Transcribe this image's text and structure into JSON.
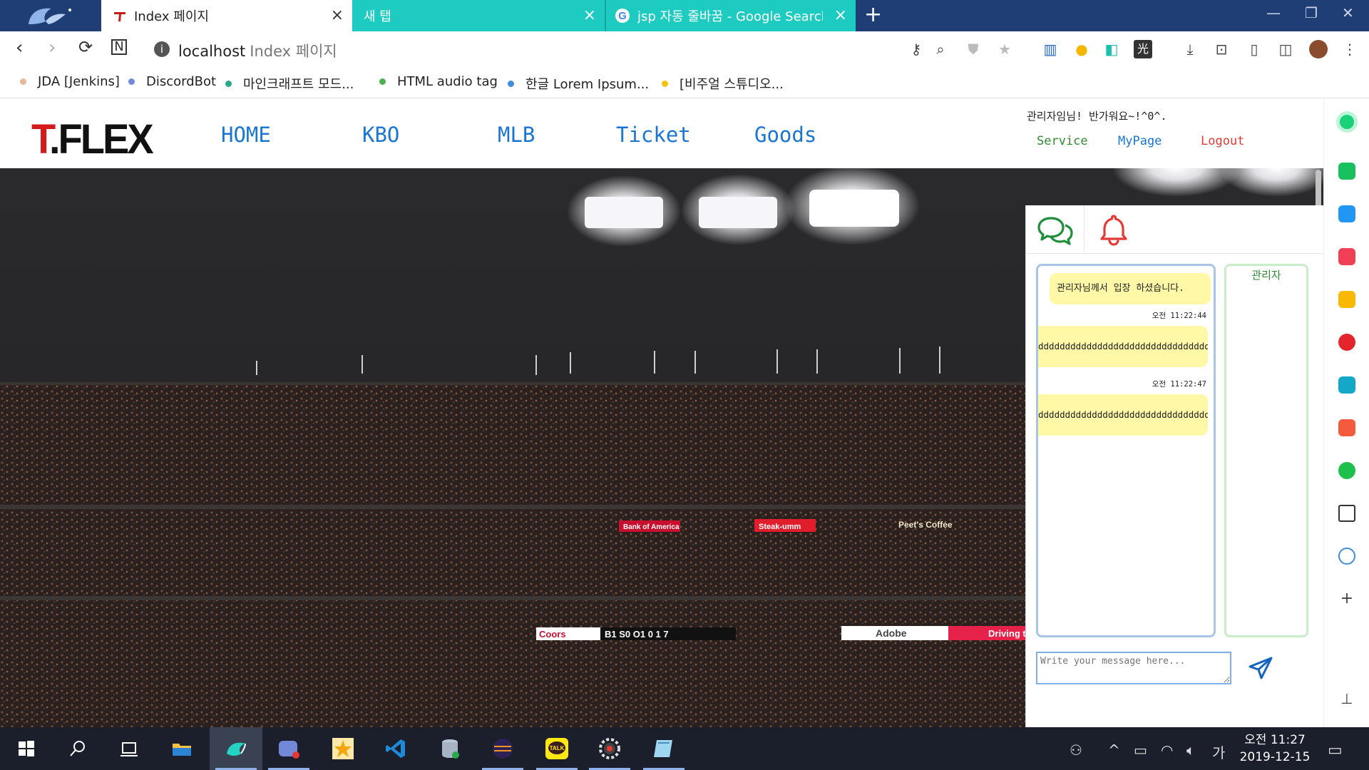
{
  "browser": {
    "tabs": [
      {
        "title": "Index 페이지"
      },
      {
        "title": "새 탭"
      },
      {
        "title": "jsp 자동 줄바꿈 - Google Search"
      }
    ],
    "url_host": "localhost",
    "url_hint": "Index 페이지",
    "bookmarks": [
      {
        "label": "JDA [Jenkins]",
        "color": "#e8b89c"
      },
      {
        "label": "DiscordBot",
        "color": "#7289da"
      },
      {
        "label": "마인크래프트 모드...",
        "color": "#2aa88a"
      },
      {
        "label": "HTML audio tag",
        "color": "#4caf50"
      },
      {
        "label": "한글 Lorem Ipsum...",
        "color": "#3b8ee0"
      },
      {
        "label": "[비주얼 스튜디오...",
        "color": "#f4c20d"
      }
    ]
  },
  "site": {
    "logo": {
      "t": "T",
      "rest": ".FLEX"
    },
    "nav": [
      "HOME",
      "KBO",
      "MLB",
      "Ticket",
      "Goods"
    ],
    "welcome": "관리자임님! 반가워요~!^0^.",
    "user_links": {
      "service": "Service",
      "mypage": "MyPage",
      "logout": "Logout"
    },
    "colors": {
      "nav": "#1976d2",
      "service": "#2e8b2e",
      "mypage": "#1976d2",
      "logout": "#e53935"
    }
  },
  "chat": {
    "system_message": "관리자님께서 입장 하셨습니다.",
    "messages": [
      {
        "text": "dddddddddddddddddddddddddddddddd",
        "time": "오전 11:22:44"
      },
      {
        "text": "dddddddddddddddddddddddddddddddd",
        "time": "오전 11:22:47"
      }
    ],
    "users": [
      "관리자"
    ],
    "input_placeholder": "Write your message here..."
  },
  "hero": {
    "signs": [
      "Bank of America",
      "Steak-umm",
      "Peet's Coffee",
      "Adobe",
      "Driving t",
      "Coors"
    ],
    "scoreboard": "B1 S0 O1 0 1 7"
  },
  "taskbar": {
    "clock_time": "오전 11:27",
    "clock_date": "2019-12-15",
    "ime": "가"
  }
}
